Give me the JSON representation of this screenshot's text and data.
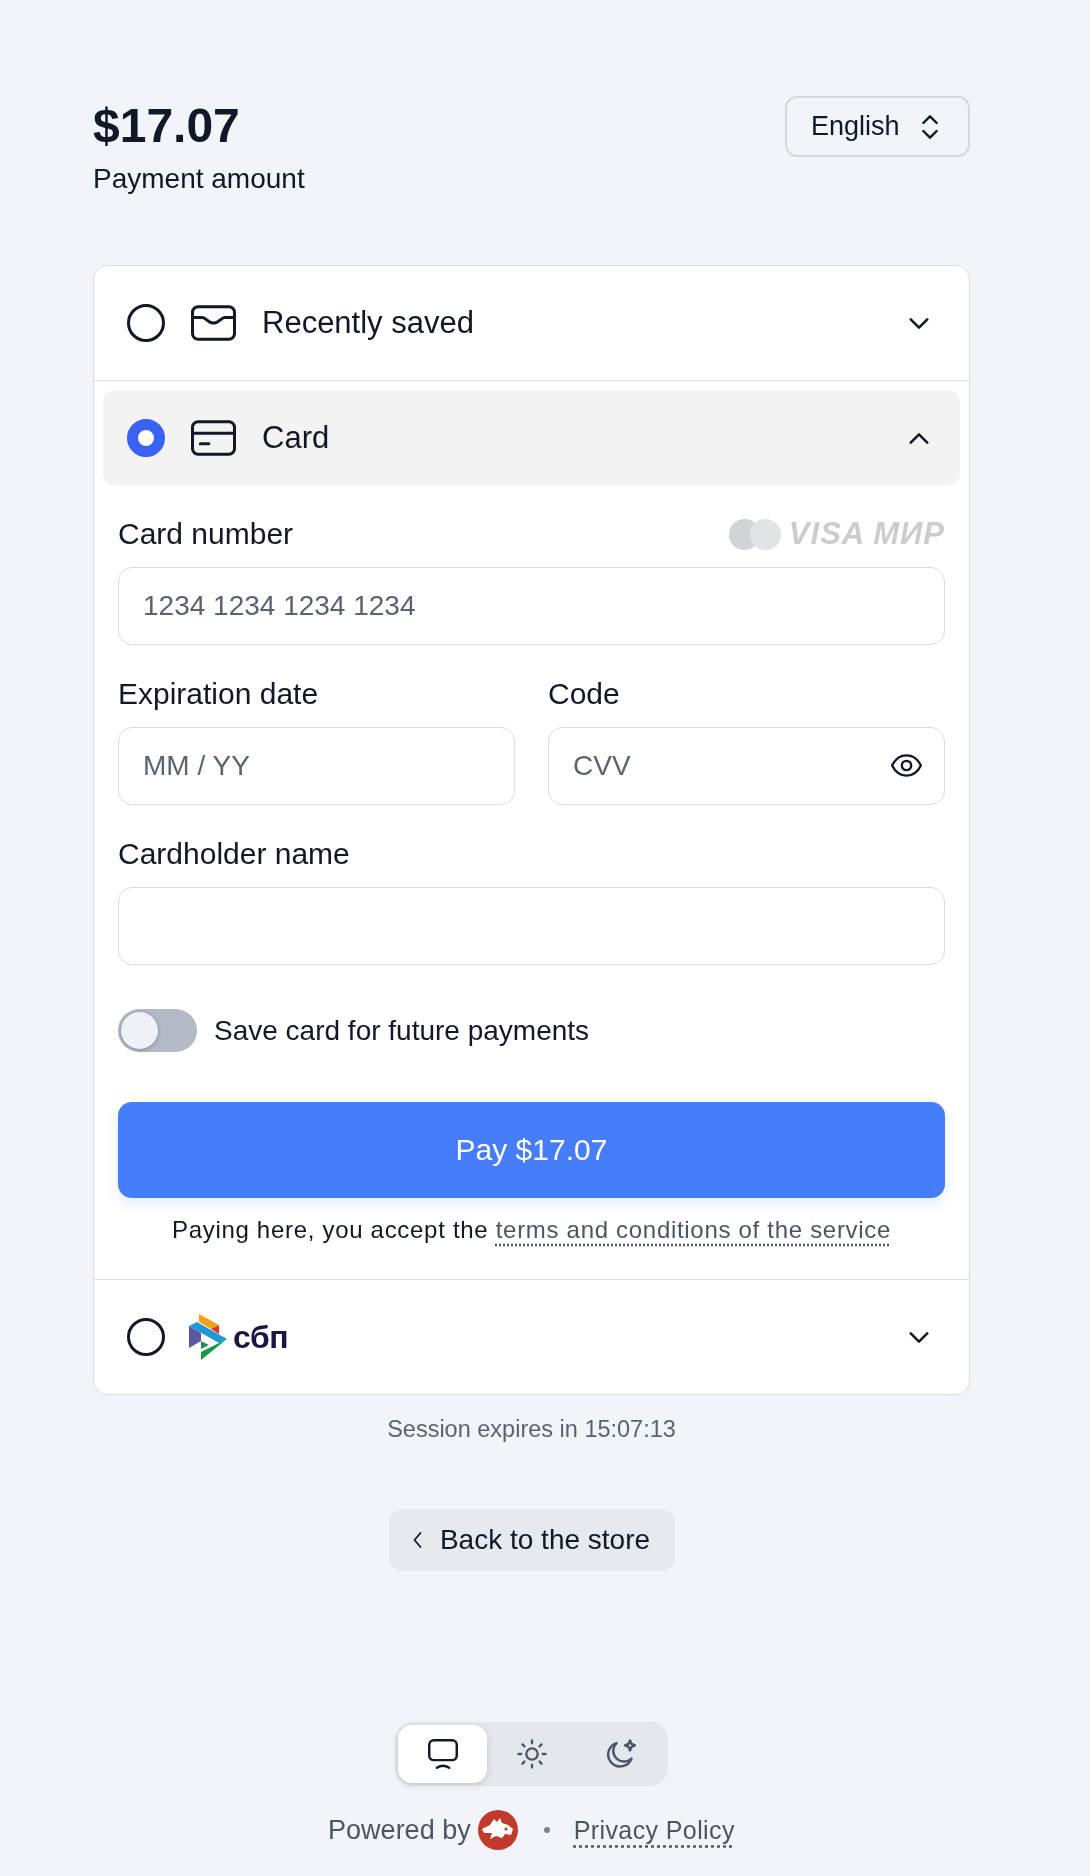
{
  "header": {
    "amount": "$17.07",
    "amount_label": "Payment amount",
    "language": "English"
  },
  "payment_methods": [
    {
      "kind": "saved",
      "label": "Recently saved",
      "selected": false,
      "expanded": false
    },
    {
      "kind": "card",
      "label": "Card",
      "selected": true,
      "expanded": true,
      "form": {
        "card_number": {
          "label": "Card number",
          "placeholder": "1234 1234 1234 1234",
          "brand_marks": [
            "VISA",
            "МИР"
          ]
        },
        "expiry": {
          "label": "Expiration date",
          "placeholder": "MM / YY"
        },
        "cvv": {
          "label": "Code",
          "placeholder": "CVV"
        },
        "cardholder": {
          "label": "Cardholder name"
        },
        "save_card": {
          "label": "Save card for future payments",
          "on": false
        },
        "pay_button": "Pay $17.07",
        "terms": {
          "text": "Paying here, you accept the",
          "link": "terms and conditions of the service"
        }
      }
    },
    {
      "kind": "sbp",
      "logo_text": "сбп",
      "selected": false,
      "expanded": false
    }
  ],
  "session_notice": "Session expires in 15:07:13",
  "back_button": "Back to the store",
  "theme_switcher": [
    {
      "kind": "system",
      "selected": true
    },
    {
      "kind": "light",
      "selected": false
    },
    {
      "kind": "dark",
      "selected": false
    }
  ],
  "footer": {
    "powered_by": "Powered by",
    "privacy_link": "Privacy Policy"
  }
}
